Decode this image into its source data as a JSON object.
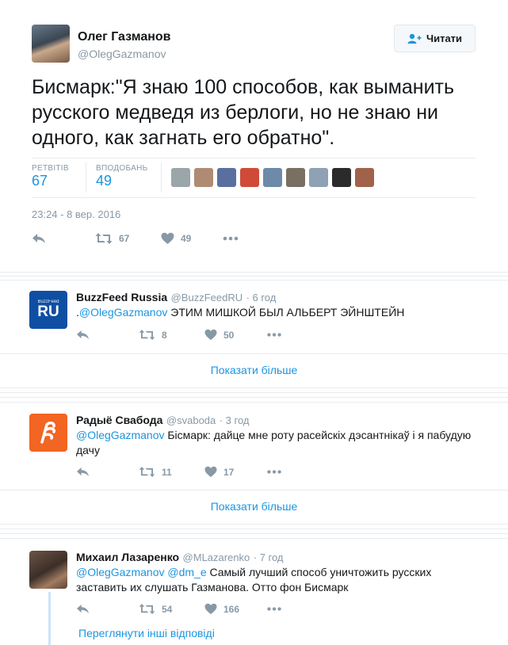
{
  "main_tweet": {
    "author_name": "Олег Газманов",
    "author_handle": "@OlegGazmanov",
    "follow_label": "Читати",
    "text": "Бисмарк:\"Я знаю 100 способов, как выманить русского медведя из берлоги, но не знаю ни одного, как загнать его обратно\".",
    "retweets_label": "РЕТВІТІВ",
    "retweets_count": "67",
    "likes_label": "ВПОДОБАНЬ",
    "likes_count": "49",
    "date": "23:24 - 8 вер. 2016",
    "actions": {
      "retweet_count": "67",
      "like_count": "49"
    }
  },
  "replies": [
    {
      "name": "BuzzFeed Russia",
      "handle": "@BuzzFeedRU",
      "time": "· 6 год",
      "avatar_text_top": "BuzzFeed",
      "avatar_text_main": "RU",
      "text_prefix": ".",
      "mention": "@OlegGazmanov",
      "text": " ЭТИМ МИШКОЙ БЫЛ АЛЬБЕРТ ЭЙНШТЕЙН",
      "retweets": "8",
      "likes": "50",
      "more": "Показати більше"
    },
    {
      "name": "Радыё Свабода",
      "handle": "@svaboda",
      "time": "· 3 год",
      "mention": "@OlegGazmanov",
      "text": " Бісмарк: дайце мне роту расейскіх дэсантнікаў і я пабудую дачу",
      "retweets": "11",
      "likes": "17",
      "more": "Показати більше"
    },
    {
      "name": "Михаил Лазаренко",
      "handle": "@MLazarenko",
      "time": "· 7 год",
      "mention": "@OlegGazmanov",
      "mention2": "@dm_e",
      "text": " Самый лучший способ уничтожить русских заставить их слушать Газманова. Отто фон Бисмарк",
      "retweets": "54",
      "likes": "166",
      "more": "Переглянути інші відповіді"
    }
  ],
  "colors": {
    "accent": "#1b95e0",
    "muted": "#8899a6",
    "border": "#e6ecf0",
    "svaboda_orange": "#f26522",
    "buzzfeed_blue": "#0e4fa3"
  },
  "icons": [
    "reply-icon",
    "retweet-icon",
    "heart-icon",
    "more-icon",
    "follow-icon"
  ]
}
